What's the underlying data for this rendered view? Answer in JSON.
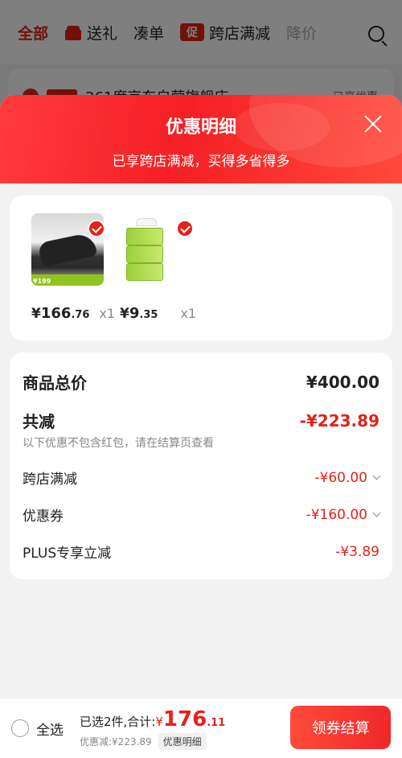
{
  "background": {
    "tabs": [
      "全部",
      "送礼",
      "凑单",
      "跨店满减",
      "降价"
    ],
    "promo_badge": "促",
    "shop_name": "361度京东自营旗舰店",
    "shop_right": "已享优惠"
  },
  "sheet": {
    "title": "优惠明细",
    "subtitle": "已享跨店满减，买得多省得多"
  },
  "products": [
    {
      "name": "361 shoe",
      "price_symbol": "¥",
      "price_int": "166",
      "price_dec": ".76",
      "qty": "x1",
      "thumb_badge": "¥199"
    },
    {
      "name": "tissue",
      "price_symbol": "¥",
      "price_int": "9",
      "price_dec": ".35",
      "qty": "x1"
    }
  ],
  "summary": {
    "total_label": "商品总价",
    "total_value": "¥400.00",
    "reduce_label": "共减",
    "reduce_value": "-¥223.89",
    "note": "以下优惠不包含红包，请在结算页查看",
    "items": [
      {
        "label": "跨店满减",
        "value": "-¥60.00",
        "expandable": true
      },
      {
        "label": "优惠券",
        "value": "-¥160.00",
        "expandable": true
      },
      {
        "label": "PLUS专享立减",
        "value": "-¥3.89",
        "expandable": false
      }
    ]
  },
  "bottom_bar": {
    "select_all": "全选",
    "selected_prefix": "已选2件,合计:",
    "total_symbol": "¥",
    "total_int": "176",
    "total_dec": ".11",
    "discount_text": "优惠减:¥223.89",
    "detail_tag": "优惠明细",
    "checkout": "领券结算"
  },
  "colors": {
    "accent": "#e2231a",
    "background": "#f2f2f2"
  }
}
